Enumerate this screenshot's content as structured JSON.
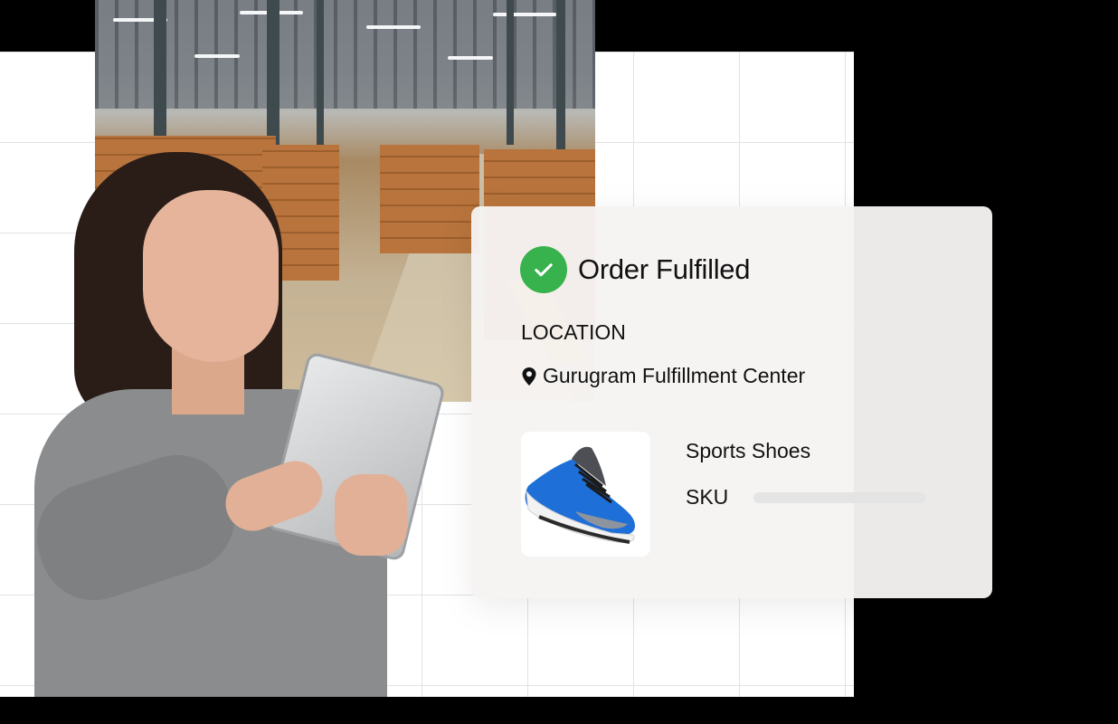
{
  "card": {
    "status_title": "Order Fulfilled",
    "location_label": "LOCATION",
    "location_value": "Gurugram Fulfillment Center",
    "product_name": "Sports Shoes",
    "sku_label": "SKU"
  },
  "icons": {
    "status": "check-circle-icon",
    "location": "map-pin-icon"
  },
  "colors": {
    "success": "#37b24d",
    "shoe": "#1f6fd8",
    "card_background": "#f6f4f3"
  }
}
